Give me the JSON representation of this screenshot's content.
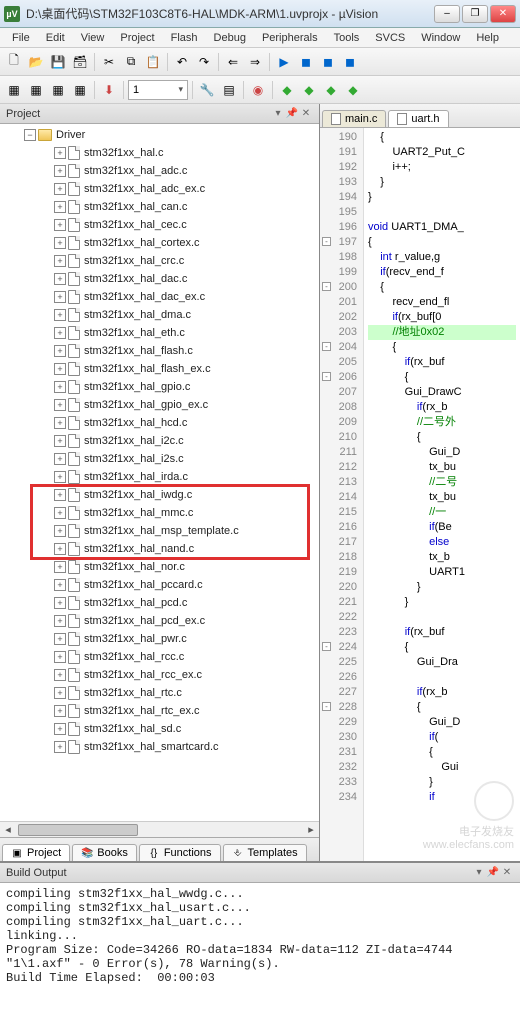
{
  "window": {
    "title": "D:\\桌面代码\\STM32F103C8T6-HAL\\MDK-ARM\\1.uvprojx - µVision",
    "app_badge": "µV"
  },
  "menu": [
    "File",
    "Edit",
    "View",
    "Project",
    "Flash",
    "Debug",
    "Peripherals",
    "Tools",
    "SVCS",
    "Window",
    "Help"
  ],
  "toolbar2_combo": "1",
  "project_pane": {
    "title": "Project",
    "folder": "Driver",
    "files": [
      "stm32f1xx_hal.c",
      "stm32f1xx_hal_adc.c",
      "stm32f1xx_hal_adc_ex.c",
      "stm32f1xx_hal_can.c",
      "stm32f1xx_hal_cec.c",
      "stm32f1xx_hal_cortex.c",
      "stm32f1xx_hal_crc.c",
      "stm32f1xx_hal_dac.c",
      "stm32f1xx_hal_dac_ex.c",
      "stm32f1xx_hal_dma.c",
      "stm32f1xx_hal_eth.c",
      "stm32f1xx_hal_flash.c",
      "stm32f1xx_hal_flash_ex.c",
      "stm32f1xx_hal_gpio.c",
      "stm32f1xx_hal_gpio_ex.c",
      "stm32f1xx_hal_hcd.c",
      "stm32f1xx_hal_i2c.c",
      "stm32f1xx_hal_i2s.c",
      "stm32f1xx_hal_irda.c",
      "stm32f1xx_hal_iwdg.c",
      "stm32f1xx_hal_mmc.c",
      "stm32f1xx_hal_msp_template.c",
      "stm32f1xx_hal_nand.c",
      "stm32f1xx_hal_nor.c",
      "stm32f1xx_hal_pccard.c",
      "stm32f1xx_hal_pcd.c",
      "stm32f1xx_hal_pcd_ex.c",
      "stm32f1xx_hal_pwr.c",
      "stm32f1xx_hal_rcc.c",
      "stm32f1xx_hal_rcc_ex.c",
      "stm32f1xx_hal_rtc.c",
      "stm32f1xx_hal_rtc_ex.c",
      "stm32f1xx_hal_sd.c",
      "stm32f1xx_hal_smartcard.c"
    ],
    "highlight_start_index": 19,
    "highlight_end_index": 22,
    "tabs": [
      "Project",
      "Books",
      "Functions",
      "Templates"
    ]
  },
  "editor": {
    "tabs": [
      {
        "label": "main.c",
        "active": false
      },
      {
        "label": "uart.h",
        "active": true
      }
    ],
    "first_line": 190,
    "lines": [
      {
        "t": "    {",
        "f": ""
      },
      {
        "t": "        UART2_Put_C",
        "f": ""
      },
      {
        "t": "        i++;",
        "f": ""
      },
      {
        "t": "    }",
        "f": ""
      },
      {
        "t": "}",
        "f": ""
      },
      {
        "t": "",
        "f": ""
      },
      {
        "t": "void UART1_DMA_",
        "f": "",
        "kw": "void"
      },
      {
        "t": "{",
        "f": "-"
      },
      {
        "t": "    int r_value,g",
        "f": "",
        "kw": "int"
      },
      {
        "t": "    if(recv_end_f",
        "f": "",
        "kw": "if"
      },
      {
        "t": "    {",
        "f": "-"
      },
      {
        "t": "        recv_end_fl",
        "f": ""
      },
      {
        "t": "        if(rx_buf[0",
        "f": "",
        "kw": "if"
      },
      {
        "t": "        //地址0x02",
        "f": "",
        "cm": true,
        "hl": true
      },
      {
        "t": "        {",
        "f": "-"
      },
      {
        "t": "            if(rx_buf",
        "f": "",
        "kw": "if"
      },
      {
        "t": "            {",
        "f": "-"
      },
      {
        "t": "            Gui_DrawC",
        "f": ""
      },
      {
        "t": "                if(rx_b",
        "f": "",
        "kw": "if"
      },
      {
        "t": "                //二号外",
        "f": "",
        "cm": true
      },
      {
        "t": "                {",
        "f": ""
      },
      {
        "t": "                    Gui_D",
        "f": ""
      },
      {
        "t": "                    tx_bu",
        "f": ""
      },
      {
        "t": "                    //二号",
        "f": "",
        "cm": true
      },
      {
        "t": "                    tx_bu",
        "f": ""
      },
      {
        "t": "                    //一",
        "f": "",
        "cm": true
      },
      {
        "t": "                    if(Be",
        "f": "",
        "kw": "if"
      },
      {
        "t": "                    else",
        "f": "",
        "kw": "else"
      },
      {
        "t": "                    tx_b",
        "f": ""
      },
      {
        "t": "                    UART1",
        "f": ""
      },
      {
        "t": "                }",
        "f": ""
      },
      {
        "t": "            }",
        "f": ""
      },
      {
        "t": "",
        "f": ""
      },
      {
        "t": "            if(rx_buf",
        "f": "",
        "kw": "if"
      },
      {
        "t": "            {",
        "f": "-"
      },
      {
        "t": "                Gui_Dra",
        "f": ""
      },
      {
        "t": "",
        "f": ""
      },
      {
        "t": "                if(rx_b",
        "f": "",
        "kw": "if"
      },
      {
        "t": "                {",
        "f": "-"
      },
      {
        "t": "                    Gui_D",
        "f": ""
      },
      {
        "t": "                    if(",
        "f": "",
        "kw": "if"
      },
      {
        "t": "                    {",
        "f": ""
      },
      {
        "t": "                        Gui",
        "f": ""
      },
      {
        "t": "                    }",
        "f": ""
      },
      {
        "t": "                    if",
        "f": "",
        "kw": "if"
      }
    ]
  },
  "build": {
    "title": "Build Output",
    "lines": [
      "compiling stm32f1xx_hal_wwdg.c...",
      "compiling stm32f1xx_hal_usart.c...",
      "compiling stm32f1xx_hal_uart.c...",
      "linking...",
      "Program Size: Code=34266 RO-data=1834 RW-data=112 ZI-data=4744",
      "\"1\\1.axf\" - 0 Error(s), 78 Warning(s).",
      "Build Time Elapsed:  00:00:03"
    ]
  },
  "watermark": {
    "line1": "电子发烧友",
    "line2": "www.elecfans.com"
  }
}
